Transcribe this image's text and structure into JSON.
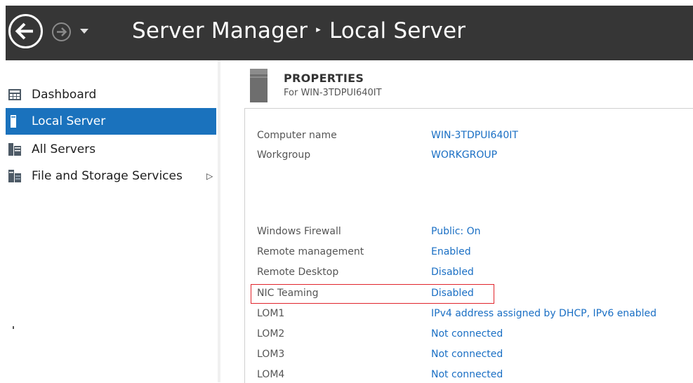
{
  "window": {
    "title_app": "Server Manager",
    "title_separator": "▸",
    "title_page": "Local Server"
  },
  "sidebar": {
    "items": [
      {
        "label": "Dashboard",
        "icon": "dashboard-icon",
        "active": false
      },
      {
        "label": "Local Server",
        "icon": "server-icon",
        "active": true
      },
      {
        "label": "All Servers",
        "icon": "servers-icon",
        "active": false
      },
      {
        "label": "File and Storage Services",
        "icon": "storage-icon",
        "active": false,
        "expand": "▷"
      }
    ]
  },
  "properties": {
    "title": "PROPERTIES",
    "subtitle": "For WIN-3TDPUI640IT",
    "rows": [
      {
        "key": "Computer name",
        "value": "WIN-3TDPUI640IT"
      },
      {
        "key": "Workgroup",
        "value": "WORKGROUP"
      },
      {
        "key": "Windows Firewall",
        "value": "Public: On"
      },
      {
        "key": "Remote management",
        "value": "Enabled"
      },
      {
        "key": "Remote Desktop",
        "value": "Disabled"
      },
      {
        "key": "NIC Teaming",
        "value": "Disabled"
      },
      {
        "key": "LOM1",
        "value": "IPv4 address assigned by DHCP, IPv6 enabled"
      },
      {
        "key": "LOM2",
        "value": "Not connected"
      },
      {
        "key": "LOM3",
        "value": "Not connected"
      },
      {
        "key": "LOM4",
        "value": "Not connected"
      }
    ]
  },
  "colors": {
    "titlebar": "#363636",
    "active_nav": "#1a72bd",
    "link": "#1a6fc4",
    "highlight_box": "#e1252c"
  }
}
